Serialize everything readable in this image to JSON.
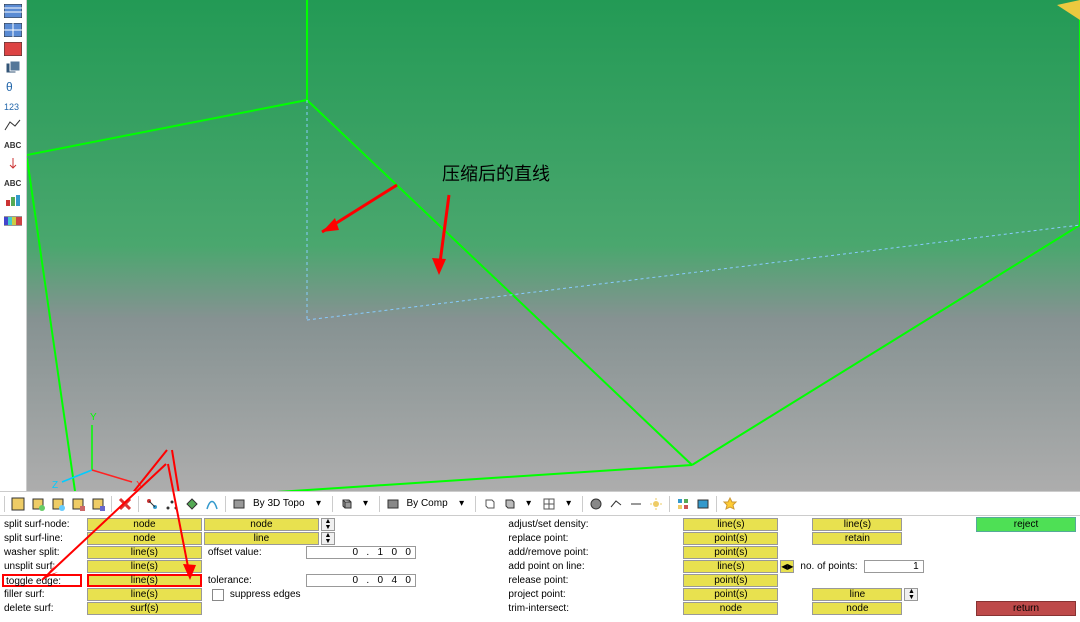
{
  "annotation": "压缩后的直线",
  "bottom_toolbar": {
    "mode1": "By 3D Topo",
    "mode2": "By Comp"
  },
  "panel": {
    "left_labels": {
      "r0": "split surf-node:",
      "r1": "split surf-line:",
      "r2": "washer split:",
      "r3": "unsplit surf:",
      "r4": "toggle edge:",
      "r5": "filler surf:",
      "r6": "delete surf:"
    },
    "col1": {
      "r0a": "node",
      "r0b": "node",
      "r1a": "node",
      "r1b": "line",
      "r2a": "line(s)",
      "r2_label": "offset value:",
      "r2_val": "0   .   1   0   0",
      "r3a": "line(s)",
      "r4a": "line(s)",
      "r4_label": "tolerance:",
      "r4_val": "0   .   0   4   0",
      "r5a": "line(s)",
      "r5_label": "suppress edges",
      "r6a": "surf(s)"
    },
    "col2_labels": {
      "r0": "adjust/set density:",
      "r1": "replace point:",
      "r2": "add/remove point:",
      "r3": "add point on line:",
      "r4": "release point:",
      "r5": "project point:",
      "r6": "trim-intersect:"
    },
    "col2": {
      "r0a": "line(s)",
      "r0b": "line(s)",
      "r1a": "point(s)",
      "r1b": "retain",
      "r2a": "point(s)",
      "r3a": "line(s)",
      "r3_label": "no. of points:",
      "r3_val": "1",
      "r4a": "point(s)",
      "r5a": "point(s)",
      "r5b": "line",
      "r6a": "node",
      "r6b": "node"
    },
    "actions": {
      "reject": "reject",
      "return": "return"
    }
  }
}
